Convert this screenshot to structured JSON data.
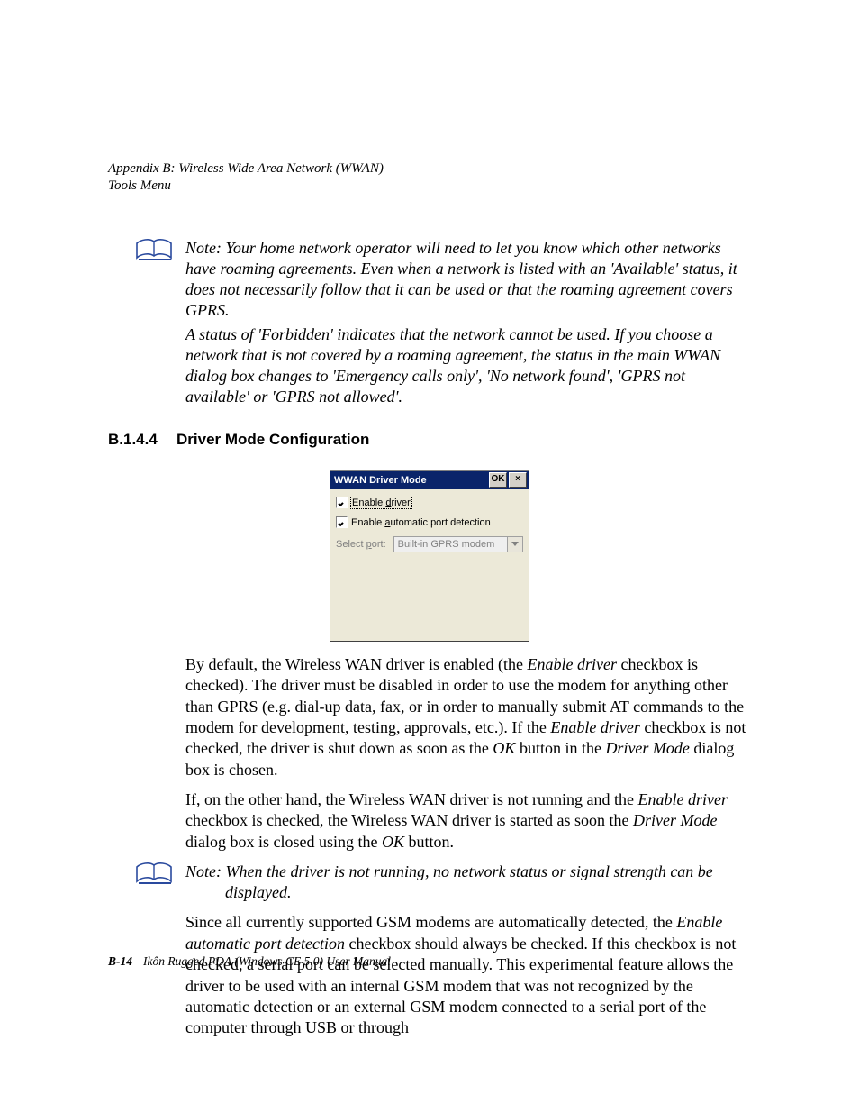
{
  "header": {
    "line1": "Appendix B: Wireless Wide Area Network (WWAN)",
    "line2": "Tools Menu"
  },
  "notes": {
    "n1": {
      "label": "Note:",
      "p1a": " Your home network operator will need to let you know which other networks have roaming agreements. Even when a network is listed with an 'Available' status, it does not necessarily follow that it can be used or that the roaming agreement covers GPRS.",
      "p2": "A status of 'Forbidden' indicates that the network cannot be used. If you choose a network that is not covered by a roaming agreement, the status in the main WWAN dialog box changes to 'Emergency calls only', 'No network found', 'GPRS not available' or 'GPRS not allowed'."
    },
    "n2": {
      "label": "Note:",
      "body": " When the driver is not running, no network status or signal strength can be displayed."
    }
  },
  "section": {
    "num": "B.1.4.4",
    "title": "Driver Mode Configuration"
  },
  "dialog": {
    "title": "WWAN Driver Mode",
    "ok": "OK",
    "close": "×",
    "chk1": {
      "pre": "Enable ",
      "acc": "d",
      "post": "river"
    },
    "chk2": {
      "pre": "Enable ",
      "acc": "a",
      "post": "utomatic port detection"
    },
    "selectLabel": {
      "pre": "Select ",
      "acc": "p",
      "post": "ort:"
    },
    "selectValue": "Built-in GPRS modem"
  },
  "paras": {
    "p1": {
      "a": "By default, the Wireless WAN driver is enabled (the ",
      "i1": "Enable driver",
      "b": " checkbox is checked). The driver must be disabled in order to use the modem for anything other than GPRS (e.g. dial-up data, fax, or in order to manually submit AT commands to the modem for development, testing, approvals, etc.). If the ",
      "i2": "Enable driver",
      "c": " checkbox is not checked, the driver is shut down as soon as the ",
      "i3": "OK",
      "d": " button in the ",
      "i4": "Driver Mode",
      "e": " dialog box is chosen."
    },
    "p2": {
      "a": "If, on the other hand, the Wireless WAN driver is not running and the ",
      "i1": "Enable driver",
      "b": " checkbox is checked, the Wireless WAN driver is started as soon the ",
      "i2": "Driver Mode",
      "c": " dialog box is closed using the ",
      "i3": "OK",
      "d": " button."
    },
    "p3": {
      "a": "Since all currently supported GSM modems are automatically detected, the ",
      "i1": "Enable automatic port detection",
      "b": " checkbox should always be checked. If this checkbox is not checked, a serial port can be selected manually. This experimental feature allows the driver to be used with an internal GSM modem that was not recognized by the automatic detection or an external GSM modem connected to a serial port of the computer through USB or through"
    }
  },
  "footer": {
    "pgnum": "B-14",
    "book": "Ikôn Rugged PDA (Windows CE 5.0) User Manual"
  }
}
